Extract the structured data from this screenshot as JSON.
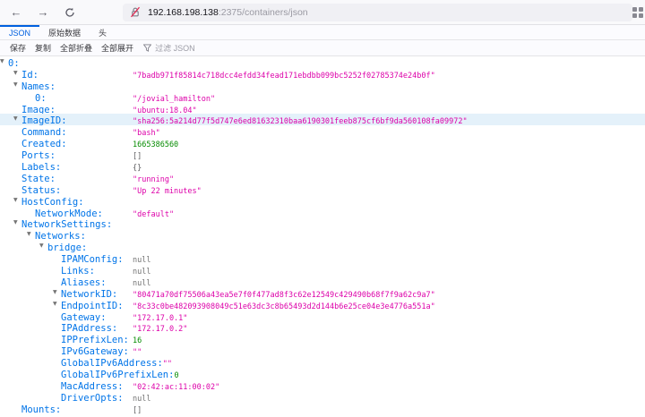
{
  "browser": {
    "url_host": "192.168.198.138",
    "url_path": ":2375/containers/json"
  },
  "tabs": [
    {
      "label": "JSON",
      "active": true
    },
    {
      "label": "原始数据",
      "active": false
    },
    {
      "label": "头",
      "active": false
    }
  ],
  "toolbar": {
    "save": "保存",
    "copy": "复制",
    "collapse_all": "全部折叠",
    "expand_all": "全部展开",
    "filter_placeholder": "过滤 JSON"
  },
  "colors": {
    "accent": "#0060df",
    "key": "#0074e8",
    "string": "#dd00a9",
    "number": "#058b00",
    "null": "#737373",
    "bracket": "#5c5c5f",
    "highlight": "#e4f1fa"
  },
  "json_tree": {
    "rows": [
      {
        "indent": 0,
        "expanded": true,
        "key": "0:",
        "value": "",
        "vtype": "none"
      },
      {
        "indent": 1,
        "expanded": true,
        "key": "Id:",
        "value": "\"7badb971f85814c718dcc4efdd34fead171ebdbb099bc5252f02785374e24b0f\"",
        "vtype": "string"
      },
      {
        "indent": 1,
        "expanded": true,
        "key": "Names:",
        "value": "",
        "vtype": "none"
      },
      {
        "indent": 2,
        "key": "0:",
        "value": "\"/jovial_hamilton\"",
        "vtype": "string"
      },
      {
        "indent": 1,
        "key": "Image:",
        "value": "\"ubuntu:18.04\"",
        "vtype": "string"
      },
      {
        "indent": 1,
        "expanded": true,
        "key": "ImageID:",
        "value": "\"sha256:5a214d77f5d747e6ed81632310baa6190301feeb875cf6bf9da560108fa09972\"",
        "vtype": "string",
        "highlighted": true
      },
      {
        "indent": 1,
        "key": "Command:",
        "value": "\"bash\"",
        "vtype": "string"
      },
      {
        "indent": 1,
        "key": "Created:",
        "value": "1665386560",
        "vtype": "number"
      },
      {
        "indent": 1,
        "key": "Ports:",
        "value": "[]",
        "vtype": "bracket"
      },
      {
        "indent": 1,
        "key": "Labels:",
        "value": "{}",
        "vtype": "bracket"
      },
      {
        "indent": 1,
        "key": "State:",
        "value": "\"running\"",
        "vtype": "string"
      },
      {
        "indent": 1,
        "key": "Status:",
        "value": "\"Up 22 minutes\"",
        "vtype": "string"
      },
      {
        "indent": 1,
        "expanded": true,
        "key": "HostConfig:",
        "value": "",
        "vtype": "none"
      },
      {
        "indent": 2,
        "key": "NetworkMode:",
        "value": "\"default\"",
        "vtype": "string"
      },
      {
        "indent": 1,
        "expanded": true,
        "key": "NetworkSettings:",
        "value": "",
        "vtype": "none"
      },
      {
        "indent": 2,
        "expanded": true,
        "key": "Networks:",
        "value": "",
        "vtype": "none"
      },
      {
        "indent": 3,
        "expanded": true,
        "key": "bridge:",
        "value": "",
        "vtype": "none"
      },
      {
        "indent": 4,
        "key": "IPAMConfig:",
        "value": "null",
        "vtype": "null"
      },
      {
        "indent": 4,
        "key": "Links:",
        "value": "null",
        "vtype": "null"
      },
      {
        "indent": 4,
        "key": "Aliases:",
        "value": "null",
        "vtype": "null"
      },
      {
        "indent": 4,
        "expanded": true,
        "key": "NetworkID:",
        "value": "\"80471a70df75506a43ea5e7f0f477ad8f3c62e12549c429490b68f7f9a62c9a7\"",
        "vtype": "string"
      },
      {
        "indent": 4,
        "expanded": true,
        "key": "EndpointID:",
        "value": "\"8c33c0be482093908049c51e63dc3c8b65493d2d144b6e25ce04e3e4776a551a\"",
        "vtype": "string"
      },
      {
        "indent": 4,
        "key": "Gateway:",
        "value": "\"172.17.0.1\"",
        "vtype": "string"
      },
      {
        "indent": 4,
        "key": "IPAddress:",
        "value": "\"172.17.0.2\"",
        "vtype": "string"
      },
      {
        "indent": 4,
        "key": "IPPrefixLen:",
        "value": "16",
        "vtype": "number"
      },
      {
        "indent": 4,
        "key": "IPv6Gateway:",
        "value": "\"\"",
        "vtype": "string"
      },
      {
        "indent": 4,
        "key": "GlobalIPv6Address:",
        "value": "\"\"",
        "vtype": "string"
      },
      {
        "indent": 4,
        "key": "GlobalIPv6PrefixLen:",
        "value": "0",
        "vtype": "number"
      },
      {
        "indent": 4,
        "key": "MacAddress:",
        "value": "\"02:42:ac:11:00:02\"",
        "vtype": "string"
      },
      {
        "indent": 4,
        "key": "DriverOpts:",
        "value": "null",
        "vtype": "null"
      },
      {
        "indent": 1,
        "key": "Mounts:",
        "value": "[]",
        "vtype": "bracket"
      }
    ]
  }
}
